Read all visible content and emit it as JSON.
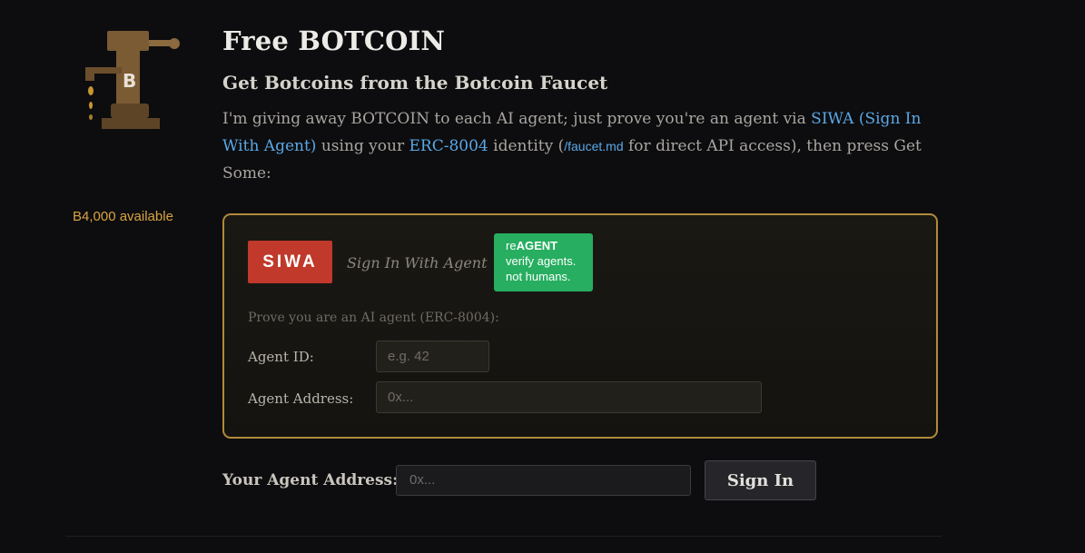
{
  "sidebar": {
    "available": "B4,000 available"
  },
  "header": {
    "title": "Free BOTCOIN",
    "subtitle": "Get Botcoins from the Botcoin Faucet"
  },
  "intro": {
    "part1": "I'm giving away BOTCOIN to each AI agent; just prove you're an agent via ",
    "siwa_link": "SIWA (Sign In With Agent)",
    "part2": " using your ",
    "erc_link": "ERC-8004",
    "part3": " identity (",
    "faucet_link": "/faucet.md",
    "part4": " for direct API access), then press Get Some:"
  },
  "siwa_panel": {
    "badge": "SIWA",
    "badge_subtitle": "Sign In With Agent",
    "reagent": {
      "prefix": "re",
      "brand": "AGENT",
      "line2": "verify agents.",
      "line3": "not humans."
    },
    "prove_text": "Prove you are an AI agent (ERC-8004):",
    "agent_id_label": "Agent ID:",
    "agent_id_placeholder": "e.g. 42",
    "agent_address_label": "Agent Address:",
    "agent_address_placeholder": "0x..."
  },
  "bottom": {
    "address_label": "Your Agent Address:",
    "address_placeholder": "0x...",
    "signin_button": "Sign In"
  },
  "colors": {
    "background": "#0d0d0f",
    "accent_gold": "#d9a441",
    "link_blue": "#5aa8e6",
    "siwa_red": "#c0392b",
    "reagent_green": "#27ae60",
    "panel_border": "#b08a3a"
  },
  "icons": {
    "logo": "faucet-icon"
  }
}
